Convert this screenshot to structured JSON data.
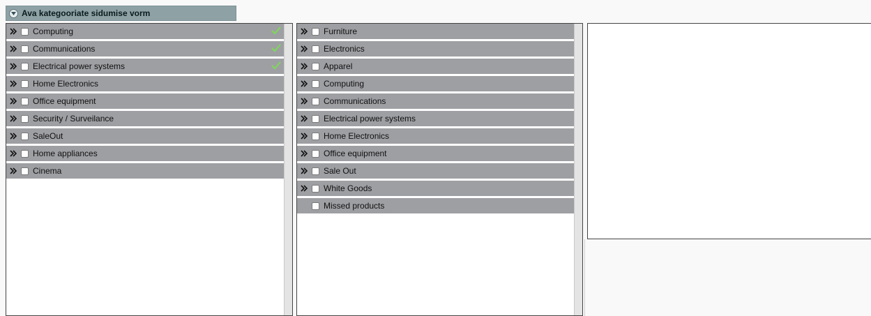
{
  "header": {
    "title": "Ava kategooriate sidumise vorm"
  },
  "left_list": {
    "items": [
      {
        "label": "Computing",
        "checked": false,
        "linked": true
      },
      {
        "label": "Communications",
        "checked": false,
        "linked": true
      },
      {
        "label": "Electrical power systems",
        "checked": false,
        "linked": true
      },
      {
        "label": "Home Electronics",
        "checked": false,
        "linked": false
      },
      {
        "label": "Office equipment",
        "checked": false,
        "linked": false
      },
      {
        "label": "Security / Surveilance",
        "checked": false,
        "linked": false
      },
      {
        "label": "SaleOut",
        "checked": false,
        "linked": false
      },
      {
        "label": "Home appliances",
        "checked": false,
        "linked": false
      },
      {
        "label": "Cinema",
        "checked": false,
        "linked": false
      }
    ]
  },
  "middle_list": {
    "items": [
      {
        "label": "Furniture",
        "checked": false,
        "expandable": true
      },
      {
        "label": "Electronics",
        "checked": false,
        "expandable": true
      },
      {
        "label": "Apparel",
        "checked": false,
        "expandable": true
      },
      {
        "label": "Computing",
        "checked": false,
        "expandable": true
      },
      {
        "label": "Communications",
        "checked": false,
        "expandable": true
      },
      {
        "label": "Electrical power systems",
        "checked": false,
        "expandable": true
      },
      {
        "label": "Home Electronics",
        "checked": false,
        "expandable": true
      },
      {
        "label": "Office equipment",
        "checked": false,
        "expandable": true
      },
      {
        "label": "Sale Out",
        "checked": false,
        "expandable": true
      },
      {
        "label": "White Goods",
        "checked": false,
        "expandable": true
      },
      {
        "label": "Missed products",
        "checked": false,
        "expandable": false
      }
    ]
  },
  "colors": {
    "row_bg": "#9e9fa3",
    "header_bg": "#8ea2a6",
    "check_mark": "#7ed957"
  }
}
